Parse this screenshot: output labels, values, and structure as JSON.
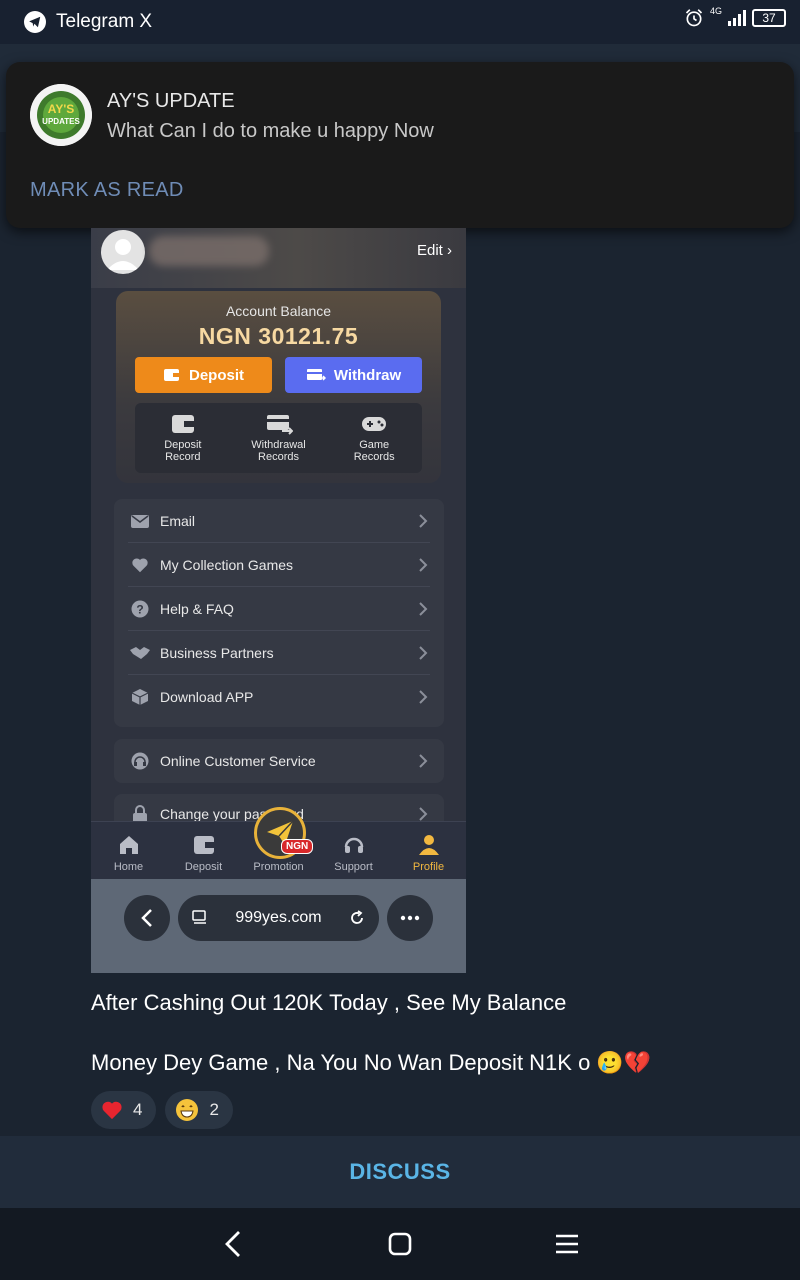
{
  "status_bar": {
    "app_name": "Telegram X",
    "network": "4G",
    "battery": "37"
  },
  "notification": {
    "title": "AY'S UPDATE",
    "message": "What Can I do to make u happy Now",
    "action": "MARK AS READ",
    "avatar_text": "AY'S UPDATES"
  },
  "screenshot": {
    "edit_label": "Edit",
    "balance_label": "Account Balance",
    "balance_value": "NGN 30121.75",
    "deposit_label": "Deposit",
    "withdraw_label": "Withdraw",
    "records": [
      {
        "line1": "Deposit",
        "line2": "Record"
      },
      {
        "line1": "Withdrawal",
        "line2": "Records"
      },
      {
        "line1": "Game",
        "line2": "Records"
      }
    ],
    "menu": [
      {
        "label": "Email",
        "icon": "email-icon"
      },
      {
        "label": "My Collection Games",
        "icon": "heart-icon"
      },
      {
        "label": "Help & FAQ",
        "icon": "question-icon"
      },
      {
        "label": "Business Partners",
        "icon": "handshake-icon"
      },
      {
        "label": "Download APP",
        "icon": "box-icon"
      }
    ],
    "customer_service": "Online Customer Service",
    "change_password": "Change your password",
    "bottom_nav": [
      {
        "label": "Home",
        "icon": "home-icon"
      },
      {
        "label": "Deposit",
        "icon": "wallet-icon"
      },
      {
        "label": "Promotion",
        "icon": "paper-plane-icon"
      },
      {
        "label": "Support",
        "icon": "headset-icon"
      },
      {
        "label": "Profile",
        "icon": "person-icon"
      }
    ],
    "promo_badge": "NGN",
    "url": "999yes.com"
  },
  "message": {
    "line1": "After Cashing Out 120K Today , See My Balance",
    "line2": "Money Dey Game , Na You No Wan Deposit N1K o",
    "emojis": "🥲💔"
  },
  "reactions": [
    {
      "emoji": "❤️",
      "count": "4"
    },
    {
      "emoji": "😁",
      "count": "2"
    }
  ],
  "discuss_label": "DISCUSS",
  "colors": {
    "accent": "#5ab5e6",
    "deposit": "#ee8a1a",
    "withdraw": "#5a6cf0",
    "profile_active": "#f2b840"
  }
}
